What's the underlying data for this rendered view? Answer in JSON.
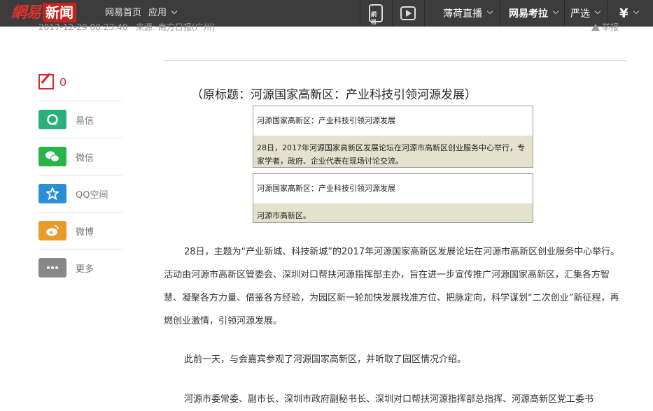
{
  "topbar": {
    "logo_text": "網易",
    "logo_badge": "新闻",
    "nav_home": "网易首页",
    "nav_app": "应用",
    "phone_label": "網易",
    "items": [
      "薄荷直播",
      "网易考拉",
      "严选",
      "¥"
    ]
  },
  "meta": {
    "datetime": "2017-12-29 08:23:40",
    "source": "来源: 南方日报(广州)",
    "report": "举报"
  },
  "share": {
    "comment_count": "0",
    "items": [
      {
        "label": "易信",
        "color": "#2bb07c",
        "icon": "yixin-icon"
      },
      {
        "label": "微信",
        "color": "#28b448",
        "icon": "wechat-icon"
      },
      {
        "label": "QQ空间",
        "color": "#2a8fd4",
        "icon": "qzone-icon"
      },
      {
        "label": "微博",
        "color": "#e89a2a",
        "icon": "weibo-icon"
      },
      {
        "label": "更多",
        "color": "#888888",
        "icon": "more-icon"
      }
    ]
  },
  "article": {
    "original_title": "（原标题：河源国家高新区：产业科技引领河源发展）",
    "images": [
      {
        "title": "河源国家高新区：产业科技引领河源发展",
        "caption": "28日，2017年河源国家高新区发展论坛在河源市高新区创业服务中心举行，专家学者，政府、企业代表在现场讨论交流。"
      },
      {
        "title": "河源国家高新区：产业科技引领河源发展",
        "caption": "河源市高新区。"
      }
    ],
    "paragraphs": [
      "28日，主题为“产业新城、科技新城”的2017年河源国家高新区发展论坛在河源市高新区创业服务中心举行。活动由河源市高新区管委会、深圳对口帮扶河源指挥部主办，旨在进一步宣传推广河源国家高新区，汇集各方智慧、凝聚各方力量、借鉴各方经验，为园区新一轮加快发展找准方位、把脉定向，科学谋划“二次创业”新征程，再燃创业激情，引领河源发展。",
      "此前一天，与会嘉宾参观了河源国家高新区，并听取了园区情况介绍。",
      "河源市委常委、副市长、深圳市政府副秘书长、深圳对口帮扶河源指挥部总指挥、河源高新区党工委书"
    ]
  }
}
